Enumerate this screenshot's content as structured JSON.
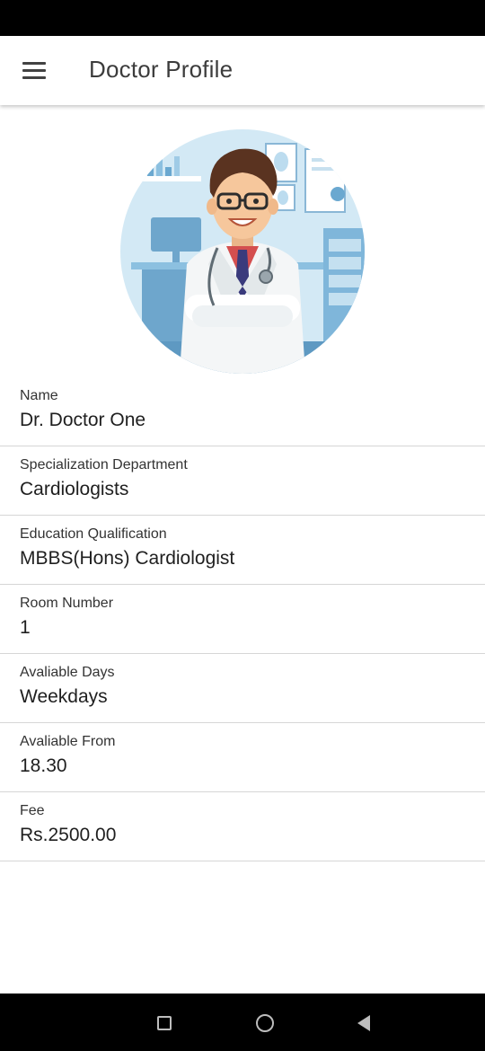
{
  "app_bar": {
    "title": "Doctor Profile",
    "menu_icon": "hamburger-menu-icon"
  },
  "avatar": {
    "illustration": "doctor-avatar-illustration",
    "colors": {
      "circle": "#cfe6f3",
      "coat": "#f4f6f7",
      "hair": "#5a3320",
      "skin": "#f6c79c",
      "tie": "#3a3b7c",
      "shirt": "#d44f4f",
      "accent": "#5aa3d0"
    }
  },
  "fields": [
    {
      "label": "Name",
      "value": "Dr. Doctor One"
    },
    {
      "label": "Specialization Department",
      "value": "Cardiologists"
    },
    {
      "label": "Education Qualification",
      "value": "MBBS(Hons) Cardiologist"
    },
    {
      "label": "Room Number",
      "value": "1"
    },
    {
      "label": "Avaliable Days",
      "value": "Weekdays"
    },
    {
      "label": "Avaliable From",
      "value": "18.30"
    },
    {
      "label": "Fee",
      "value": "Rs.2500.00"
    }
  ],
  "nav_bar": {
    "recents_icon": "recents-square-icon",
    "home_icon": "home-circle-icon",
    "back_icon": "back-triangle-icon"
  }
}
